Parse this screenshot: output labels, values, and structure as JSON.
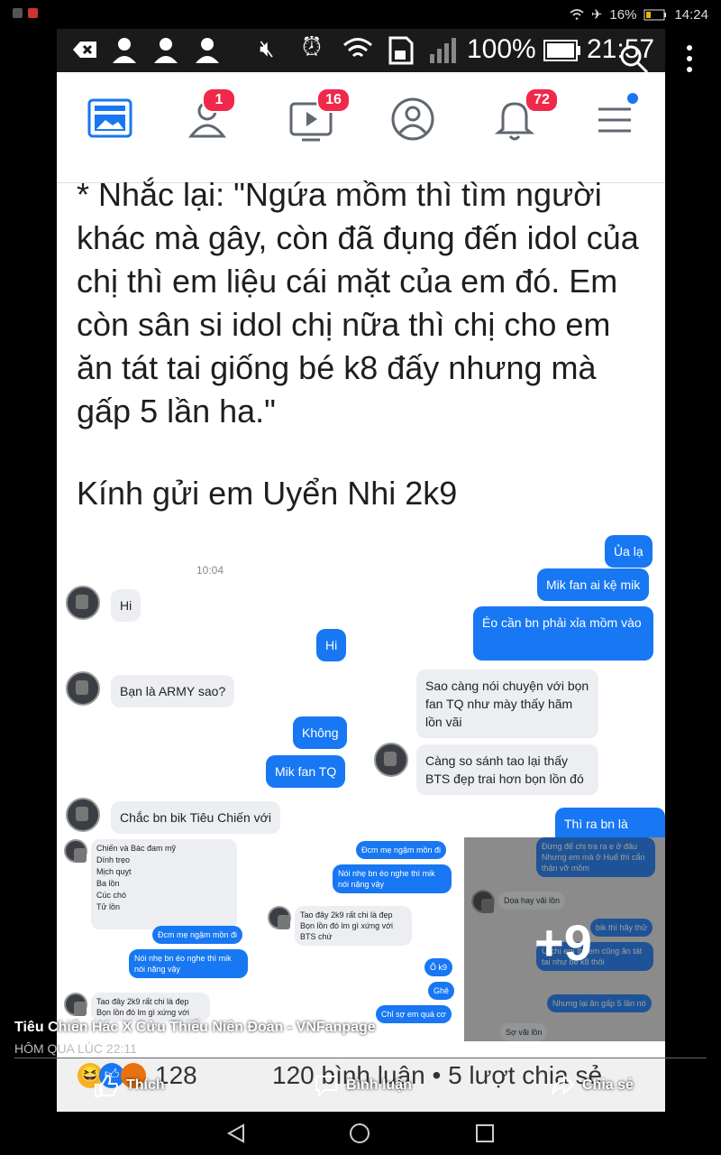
{
  "status_bar": {
    "battery": "16%",
    "time": "14:24"
  },
  "inner_status": {
    "signal": "100%",
    "time": "21:57"
  },
  "fb_nav": {
    "friends_badge": "1",
    "watch_badge": "16",
    "notif_badge": "72"
  },
  "post": {
    "text": "* Nhắc lại: \"Ngứa mồm thì tìm người khác mà gây, còn đã đụng đến idol của chị thì em liệu cái mặt của em đó. Em còn sân si idol chị nữa thì chị cho em ăn tát tai giống bé k8 đấy nhưng mà gấp 5 lần ha.\"",
    "signoff": "Kính gửi em Uyển Nhi 2k9"
  },
  "chat1": {
    "time": "10:04",
    "m1": "Hi",
    "m2": "Hi",
    "m3": "Bạn là ARMY sao?",
    "m4": "Không",
    "m5": "Mik fan TQ",
    "m6": "Chắc bn bik Tiêu Chiến với"
  },
  "chat2": {
    "m1": "Ủa lạ",
    "m2": "Mik fan ai kệ mik",
    "m3": "Éo cần bn phải xỉa mồm vào",
    "m4": "Sao càng nói chuyện với bọn fan TQ như mày thấy hãm lồn vãi",
    "m5": "Càng so sánh tao lại thấy BTS đẹp trai hơn bọn lồn đó",
    "m6": "Thì ra bn là ARMY"
  },
  "thumb1": {
    "list": "Chiến và Bác đam mỹ\nDính trẹo\nMịch quỵt\nBa lồn\nCúc chó\nTử lồn",
    "b1": "Đcm mẹ ngậm mồn đi",
    "b2": "Nói nhẹ bn éo nghe thì mik nói nặng vậy",
    "b3": "Tao đây 2k9 rất chi là đẹp Bọn lồn đó lm gì xứng với"
  },
  "thumb2": {
    "b1": "Đcm mẹ ngậm mồn đi",
    "b2": "Nói nhẹ bn éo nghe thì mik nói nặng vậy",
    "b3": "Tao đây 2k9 rất chi là đẹp Bọn lồn đó lm gì xứng với BTS chứ",
    "b4": "Ô k9",
    "b5": "Ghê",
    "b6": "Chỉ sợ em quá cơ"
  },
  "thumb3": {
    "b1": "Đừng để chị tra ra e ở đâu Nhưng em mà ở Huế thì cẩn thận vỡ mồm",
    "b2": "Dọa hay vãi lồn",
    "b3": "bik thì hãy thử",
    "b4": "Ừ chị em thì em cũng ăn tát tai như bé k8 thôi",
    "b5": "Nhưng lại ăn gấp 5 lần nó",
    "b6": "Sợ vãi lồn",
    "more": "+9"
  },
  "caption": {
    "title": "Tiêu Chiến Hác X Cửu Thiếu Niên Đoàn - VNFanpage",
    "date": "HÔM QUA LÚC 22:11"
  },
  "stats": {
    "reactions": "128",
    "comments_shares": "120 bình luận • 5 lượt chia sẻ"
  },
  "actions": {
    "like": "Thích",
    "comment": "Bình luận",
    "share": "Chia sẻ"
  },
  "colors": {
    "blue": "#1877f2",
    "badge": "#f02849"
  }
}
